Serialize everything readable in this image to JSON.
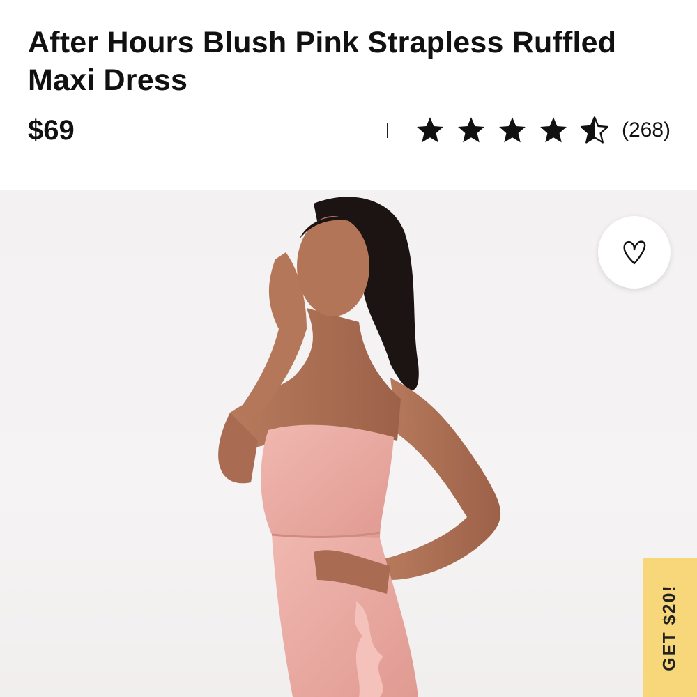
{
  "product": {
    "title": "After Hours Blush Pink Strapless Ruffled Maxi Dress",
    "price": "$69",
    "rating_value": 4.5,
    "rating_max": 5,
    "review_count": "(268)"
  },
  "icons": {
    "star": "star-icon",
    "half_star": "half-star-icon",
    "favorite": "heart-icon"
  },
  "promo": {
    "label": "GET $20!"
  },
  "colors": {
    "promo_bg": "#f7d77a",
    "text": "#111111",
    "dress": "#e9aaa2"
  }
}
